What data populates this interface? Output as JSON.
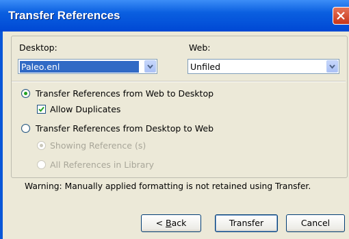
{
  "window": {
    "title": "Transfer References"
  },
  "desktop": {
    "label": "Desktop:",
    "value": "Paleo.enl"
  },
  "web": {
    "label": "Web:",
    "value": "Unfiled"
  },
  "options": {
    "web_to_desktop": "Transfer References from Web to Desktop",
    "allow_duplicates": "Allow Duplicates",
    "desktop_to_web": "Transfer References from Desktop to Web",
    "showing_reference": "Showing Reference (s)",
    "all_references": "All References in Library"
  },
  "state": {
    "web_to_desktop_selected": true,
    "allow_duplicates_checked": true,
    "showing_reference_selected": true
  },
  "warning": "Warning: Manually applied formatting is not retained using Transfer.",
  "buttons": {
    "back_prefix": "< ",
    "back_key": "B",
    "back_rest": "ack",
    "transfer": "Transfer",
    "cancel": "Cancel"
  },
  "colors": {
    "titlebar": "#0a5fe0",
    "client": "#ece9d8",
    "selection": "#316ac5",
    "close": "#c7361a"
  },
  "icons": {
    "close": "close-icon",
    "dropdown": "chevron-down-icon",
    "check": "checkmark-icon"
  }
}
